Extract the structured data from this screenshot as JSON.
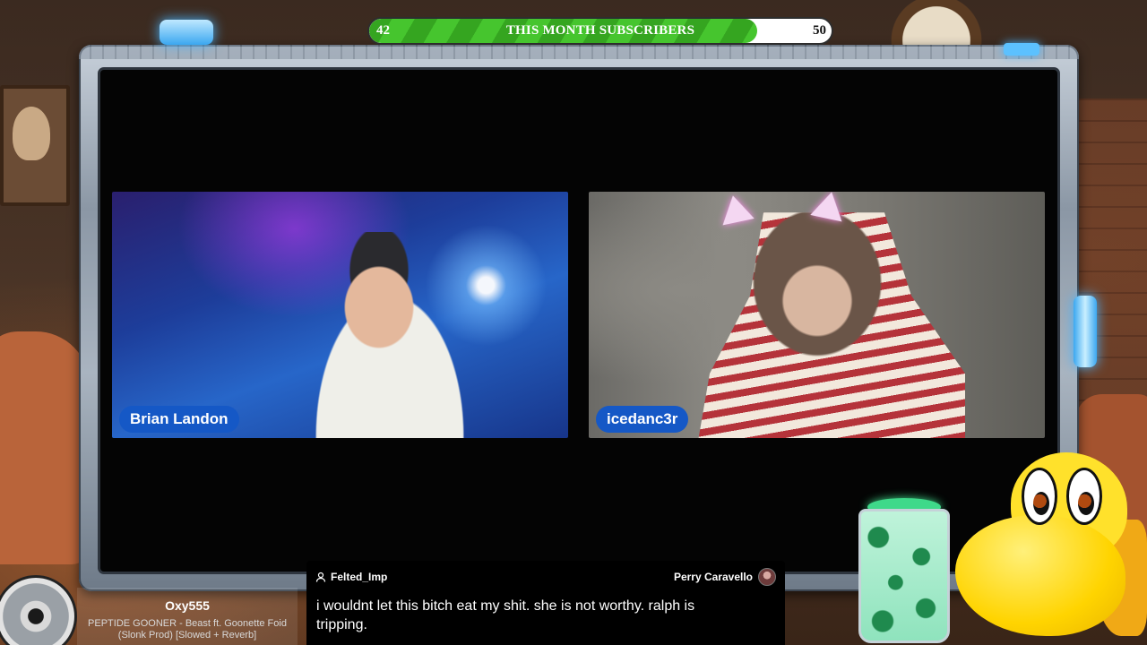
{
  "goal_bar": {
    "start_value": "42",
    "end_value": "50",
    "title": "THIS MONTH SUBSCRIBERS",
    "progress_fraction": 0.84
  },
  "participants": [
    {
      "name": "Brian Landon"
    },
    {
      "name": "icedanc3r"
    }
  ],
  "chat": {
    "username": "Felted_Imp",
    "reply_to": "Perry Caravello",
    "message": "i wouldnt let this bitch eat my shit. she is not worthy. ralph is tripping."
  },
  "now_playing": {
    "requested_by": "Oxy555",
    "track": "PEPTIDE GOONER - Beast ft. Goonette Foid (Slonk Prod) [Slowed + Reverb]"
  },
  "colors": {
    "name_tag": "#1558c6",
    "goal_fill": "#46c52e",
    "frame_glow": "#48b5ff"
  }
}
